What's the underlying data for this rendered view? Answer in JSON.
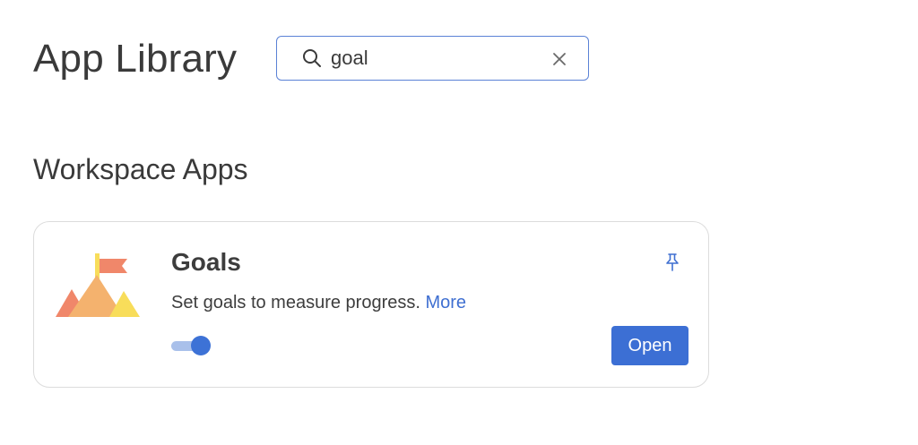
{
  "header": {
    "title": "App Library"
  },
  "search": {
    "value": "goal",
    "icon": "search-icon",
    "clear_icon": "close-icon"
  },
  "section": {
    "title": "Workspace Apps"
  },
  "app_card": {
    "name": "Goals",
    "description": "Set goals to measure progress.",
    "more_label": "More",
    "open_label": "Open",
    "enabled": true,
    "logo_icon": "mountain-flag-icon",
    "pin_icon": "pin-icon"
  },
  "colors": {
    "accent": "#3c6fd4",
    "search_border": "#5b82d6",
    "toggle_track": "#a9c0ea",
    "logo_flag": "#f0876a",
    "logo_mountain_left": "#f0876a",
    "logo_mountain_middle": "#f4b26e",
    "logo_mountain_right": "#f8dd5a",
    "logo_pole": "#f8dd5a"
  }
}
